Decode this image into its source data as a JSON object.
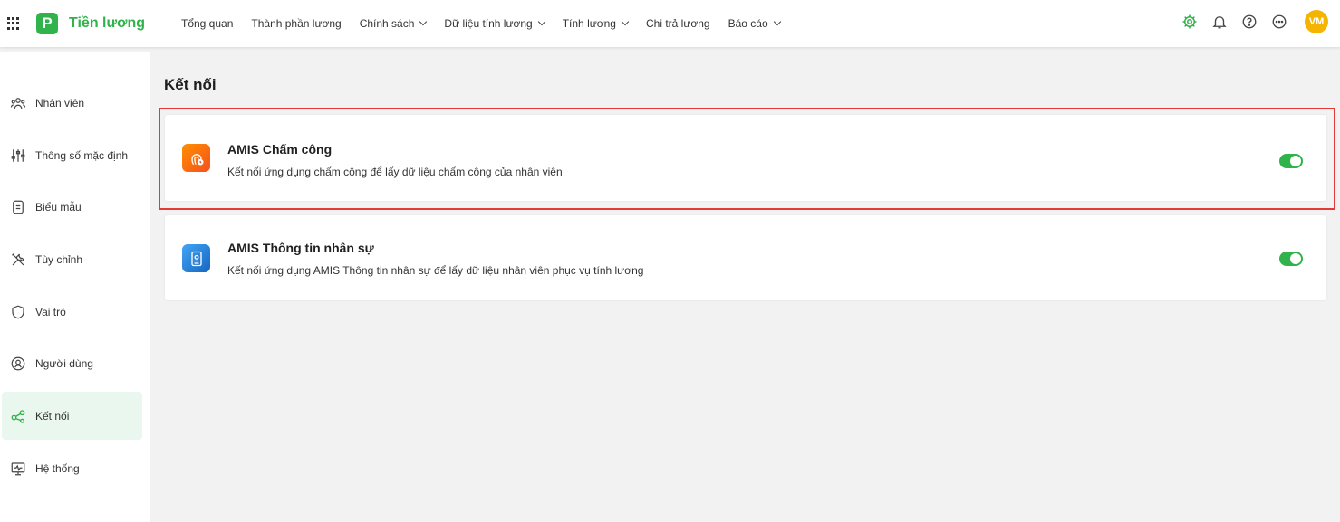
{
  "app": {
    "name": "Tiền lương",
    "logo_letter": "P"
  },
  "nav": [
    {
      "label": "Tổng quan",
      "dropdown": false
    },
    {
      "label": "Thành phần lương",
      "dropdown": false
    },
    {
      "label": "Chính sách",
      "dropdown": true
    },
    {
      "label": "Dữ liệu tính lương",
      "dropdown": true
    },
    {
      "label": "Tính lương",
      "dropdown": true
    },
    {
      "label": "Chi trả lương",
      "dropdown": false
    },
    {
      "label": "Báo cáo",
      "dropdown": true
    }
  ],
  "user": {
    "initials": "VM"
  },
  "sidebar": {
    "items": [
      {
        "label": "Nhân viên",
        "icon": "people-icon"
      },
      {
        "label": "Thông số mặc định",
        "icon": "sliders-icon"
      },
      {
        "label": "Biểu mẫu",
        "icon": "document-icon"
      },
      {
        "label": "Tùy chỉnh",
        "icon": "tools-icon"
      },
      {
        "label": "Vai trò",
        "icon": "shield-icon"
      },
      {
        "label": "Người dùng",
        "icon": "user-circle-icon"
      },
      {
        "label": "Kết nối",
        "icon": "share-icon",
        "active": true
      },
      {
        "label": "Hệ thống",
        "icon": "monitor-icon"
      }
    ]
  },
  "main": {
    "title": "Kết nối",
    "connections": [
      {
        "title": "AMIS Chấm công",
        "description": "Kết nối ứng dụng chấm công để lấy dữ liệu chấm công của nhân viên",
        "enabled": true,
        "icon": "fingerprint-icon",
        "color": "#ff6d00"
      },
      {
        "title": "AMIS Thông tin nhân sự",
        "description": "Kết nối ứng dụng AMIS Thông tin nhân sự để lấy dữ liệu nhân viên phục vụ tính lương",
        "enabled": true,
        "icon": "id-card-icon",
        "color": "#1e88e5"
      }
    ]
  },
  "colors": {
    "brand": "#2fb34a",
    "highlight": "#e53935",
    "avatar": "#f4b400"
  }
}
